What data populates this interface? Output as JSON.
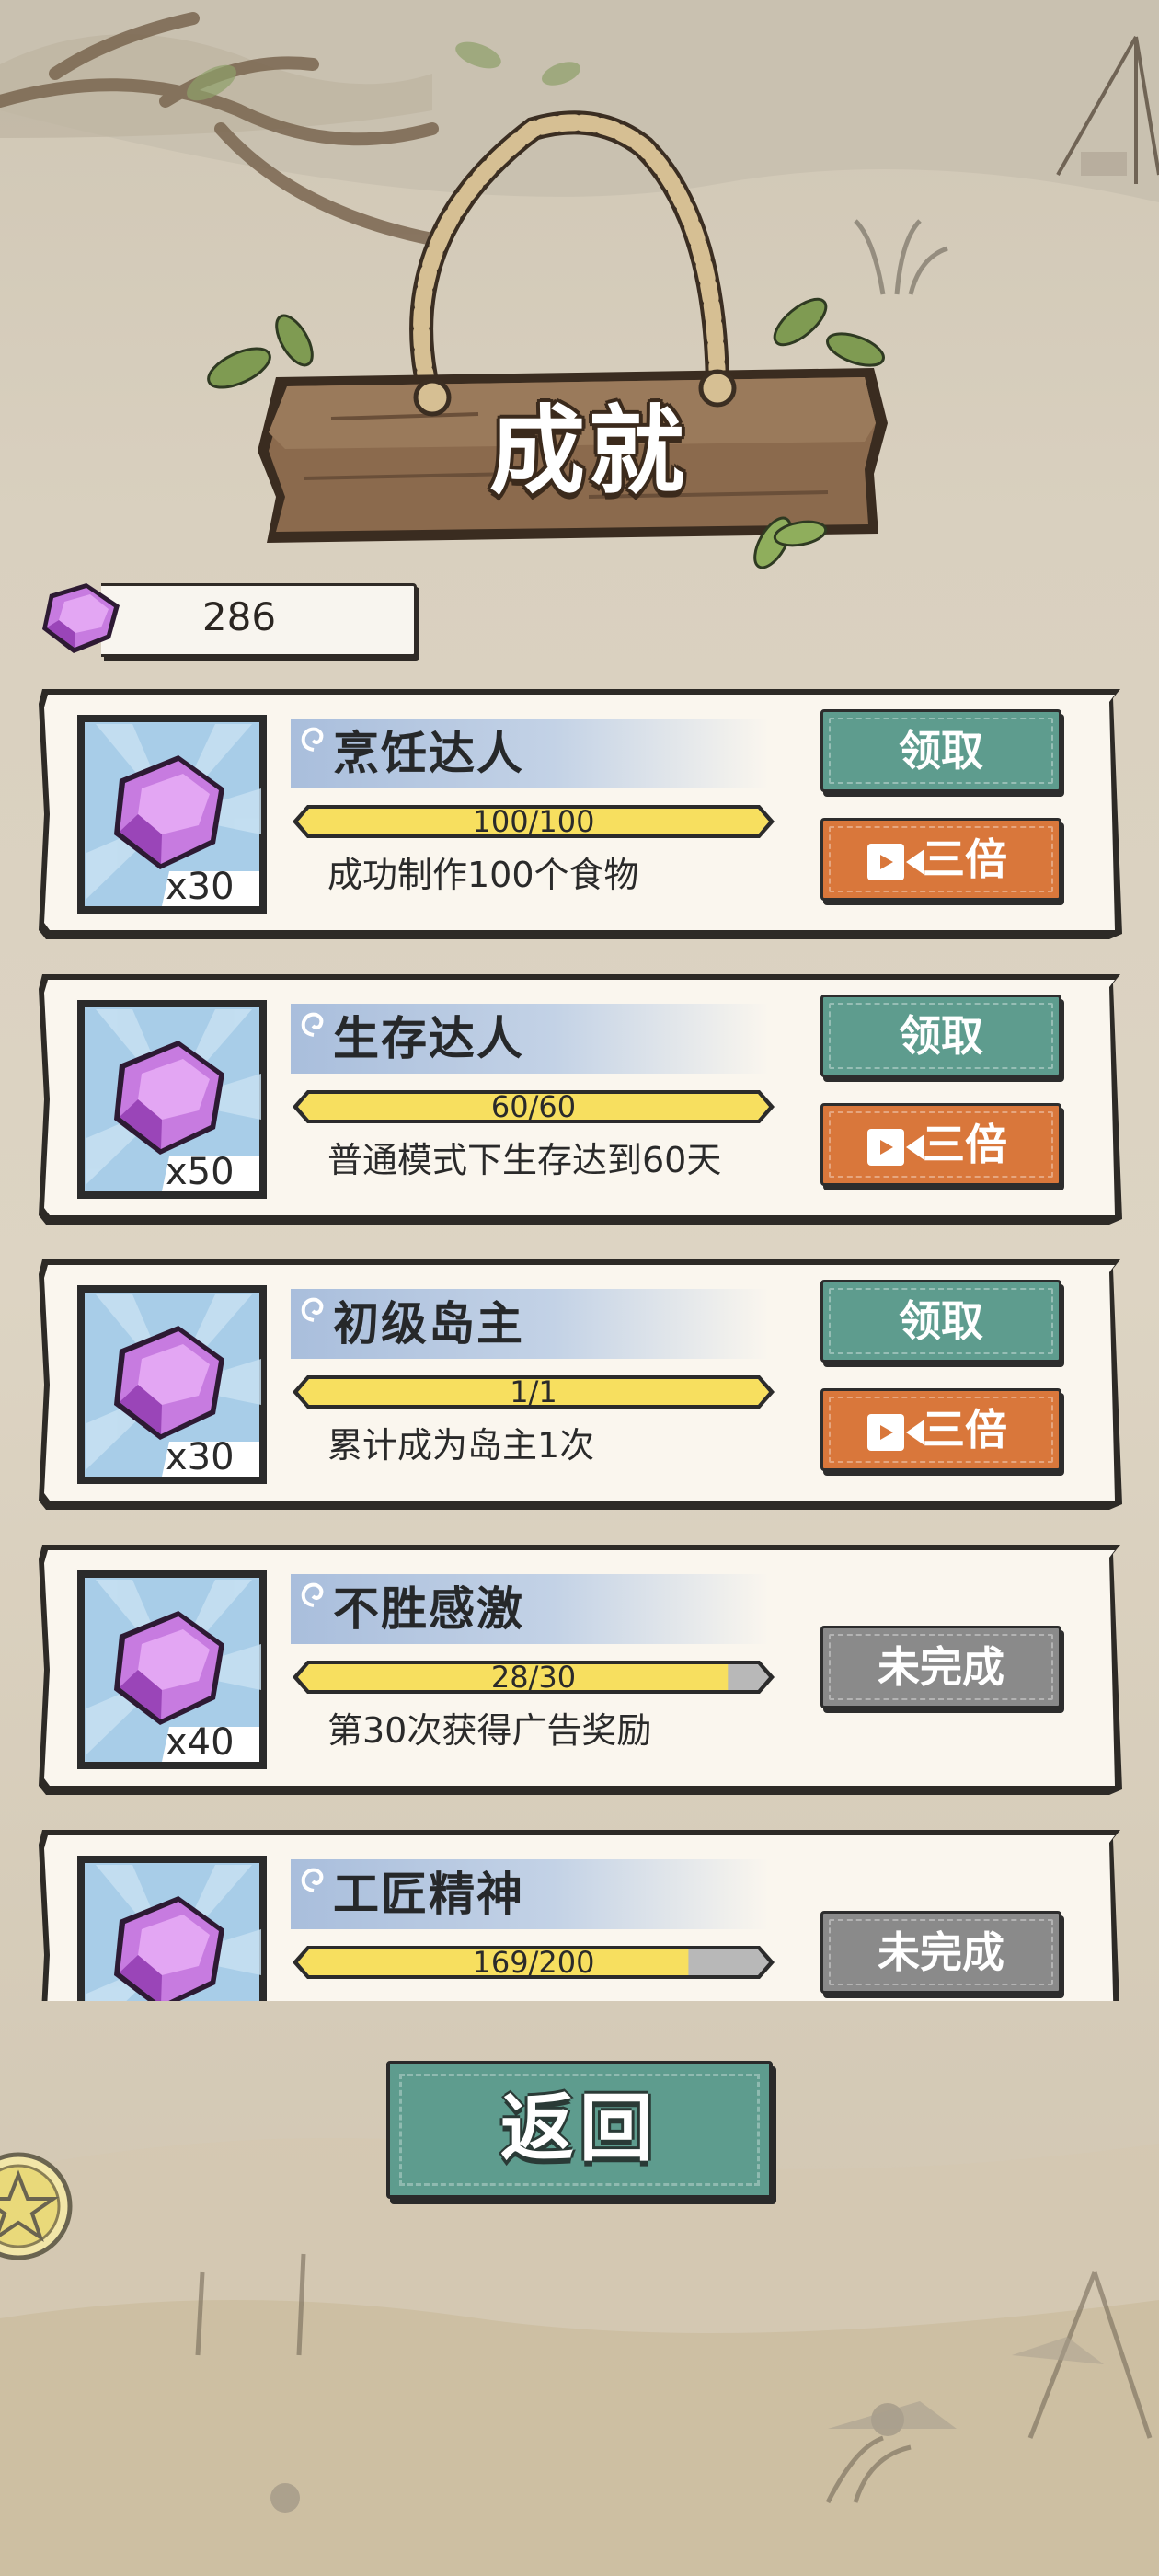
{
  "header": {
    "title": "成就"
  },
  "currency": {
    "gem_count": "286",
    "icon": "purple-gem-icon"
  },
  "achievements": [
    {
      "title": "烹饪达人",
      "progress_text": "100/100",
      "progress": 1.0,
      "description": "成功制作100个食物",
      "reward_count": "x30",
      "status": "claimable",
      "claim_label": "领取",
      "triple_label": "三倍"
    },
    {
      "title": "生存达人",
      "progress_text": "60/60",
      "progress": 1.0,
      "description": "普通模式下生存达到60天",
      "reward_count": "x50",
      "status": "claimable",
      "claim_label": "领取",
      "triple_label": "三倍"
    },
    {
      "title": "初级岛主",
      "progress_text": "1/1",
      "progress": 1.0,
      "description": "累计成为岛主1次",
      "reward_count": "x30",
      "status": "claimable",
      "claim_label": "领取",
      "triple_label": "三倍"
    },
    {
      "title": "不胜感激",
      "progress_text": "28/30",
      "progress": 0.933,
      "description": "第30次获得广告奖励",
      "reward_count": "x40",
      "status": "incomplete",
      "incomplete_label": "未完成"
    },
    {
      "title": "工匠精神",
      "progress_text": "169/200",
      "progress": 0.845,
      "description": "",
      "reward_count": "",
      "status": "incomplete",
      "incomplete_label": "未完成"
    }
  ],
  "footer": {
    "back_label": "返回"
  },
  "colors": {
    "claim_button": "#5e9c8e",
    "triple_button": "#d9773b",
    "incomplete_button": "#8a8a8a",
    "progress_fill": "#f7df5f",
    "progress_empty": "#b8b8b8",
    "gem": "#c77be0"
  }
}
